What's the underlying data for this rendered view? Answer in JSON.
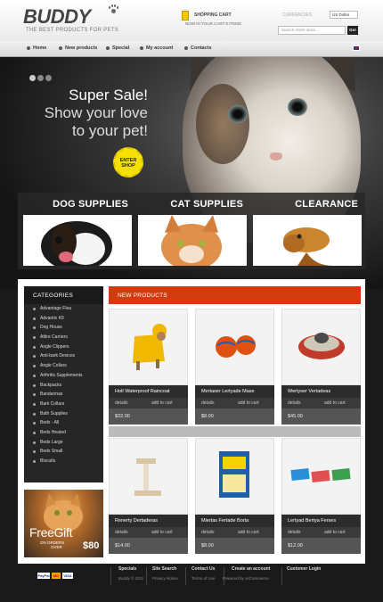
{
  "header": {
    "logo": "BUDDY",
    "tagline": "THE BEST PRODUCTS FOR PETS",
    "cart_title": "SHOPPING CART",
    "cart_text": "NOW IN YOUR CART 0 ITEMS",
    "currency_label": "CURRENCIES",
    "currency_value": "US Dollar",
    "search_placeholder": "Search entire store...",
    "go_label": "Go!"
  },
  "nav": {
    "items": [
      {
        "label": "Home"
      },
      {
        "label": "New products"
      },
      {
        "label": "Special"
      },
      {
        "label": "My account"
      },
      {
        "label": "Contacts"
      }
    ]
  },
  "hero": {
    "title": "Super Sale!",
    "subtitle_line1": "Show your love",
    "subtitle_line2": "to your pet!",
    "badge_line1": "ENTER",
    "badge_line2": "SHOP"
  },
  "categories_banner": [
    {
      "label": "DOG SUPPLIES"
    },
    {
      "label": "CAT SUPPLIES"
    },
    {
      "label": "CLEARANCE"
    }
  ],
  "sidebar": {
    "heading": "CATEGORIES",
    "items": [
      "Advantage Flea",
      "Advantix K9",
      "Dog House",
      "Attire Carriers",
      "Angle Clippers",
      "Anti-bark Devices",
      "Angle Collars",
      "Arthritis Supplements",
      "Backpacks",
      "Bandannas",
      "Bark Collars",
      "Bath Supplies",
      "Beds - All",
      "Beds Heated",
      "Beds Large",
      "Beds Small",
      "Biscuits"
    ]
  },
  "gift": {
    "title": "FreeGift",
    "sub_line1": "ON ORDERS",
    "sub_line2": "OVER",
    "price": "$80"
  },
  "products": {
    "heading": "NEW PRODUCTS",
    "details_label": "details",
    "add_label": "add to cart",
    "items": [
      {
        "name": "Hotl Waterproof Raincoat",
        "price": "$32.00"
      },
      {
        "name": "Mertaser Lertyade Mase",
        "price": "$8.00"
      },
      {
        "name": "Wertyser Vertadeas",
        "price": "$45.00"
      },
      {
        "name": "Renerty Dertaderas",
        "price": "$14.00"
      },
      {
        "name": "Miertas Fertade Borta",
        "price": "$8.00"
      },
      {
        "name": "Lertyad Bertya Ferses",
        "price": "$12.00"
      }
    ]
  },
  "footer": {
    "links": [
      "Specials",
      "Site Search",
      "Contact Us",
      "Create an account",
      "Customer Login"
    ],
    "copyright": "Buddy © 2011",
    "privacy": "Privacy Notice",
    "terms": "Terms of Use",
    "powered": "Powered by osCommerce",
    "pay_logos": [
      "PayPal",
      "MC",
      "VISA"
    ]
  },
  "colors": {
    "accent": "#d33a10",
    "dark": "#1a1a1a",
    "badge": "#f5e000"
  }
}
